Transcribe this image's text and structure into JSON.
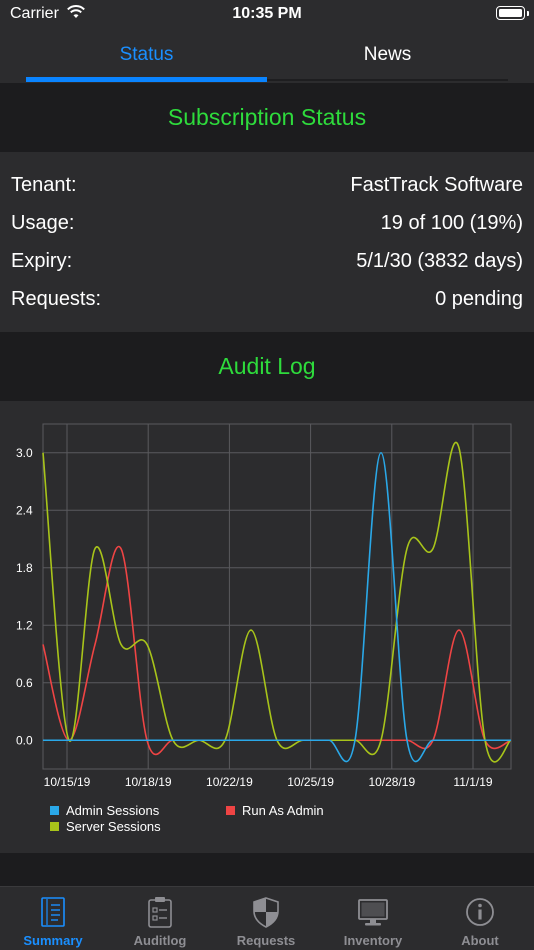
{
  "status_bar": {
    "carrier": "Carrier",
    "time": "10:35 PM"
  },
  "tabs": [
    {
      "label": "Status",
      "active": true
    },
    {
      "label": "News",
      "active": false
    }
  ],
  "subscription": {
    "header": "Subscription Status",
    "rows": [
      {
        "key": "Tenant:",
        "value": "FastTrack Software"
      },
      {
        "key": "Usage:",
        "value": "19 of 100 (19%)"
      },
      {
        "key": "Expiry:",
        "value": "5/1/30 (3832 days)"
      },
      {
        "key": "Requests:",
        "value": "0 pending"
      }
    ]
  },
  "audit": {
    "header": "Audit Log"
  },
  "colors": {
    "accent": "#0a84ff",
    "header_green": "#2edb3c",
    "admin_sessions": "#2aa8e8",
    "run_as_admin": "#ef4444",
    "server_sessions": "#a8c41a"
  },
  "chart_data": {
    "type": "line",
    "x_tick_labels": [
      "10/15/19",
      "10/18/19",
      "10/22/19",
      "10/25/19",
      "10/28/19",
      "11/1/19"
    ],
    "x": [
      0,
      1,
      2,
      3,
      4,
      5,
      6,
      7,
      8,
      9,
      10,
      11,
      12,
      13,
      14,
      15,
      16,
      17,
      18
    ],
    "ylim": [
      -0.3,
      3.3
    ],
    "y_ticks": [
      0.0,
      0.6,
      1.2,
      1.8,
      2.4,
      3.0
    ],
    "y_tick_labels": [
      "0.0",
      "0.6",
      "1.2",
      "1.8",
      "2.4",
      "3.0"
    ],
    "grid": true,
    "legend_position": "bottom-left",
    "series": [
      {
        "name": "Admin Sessions",
        "color": "#2aa8e8",
        "values": [
          0,
          0,
          0,
          0,
          0,
          0,
          0,
          0,
          0,
          0,
          0,
          0,
          0,
          3,
          0,
          0,
          0,
          0,
          0
        ]
      },
      {
        "name": "Run As Admin",
        "color": "#ef4444",
        "values": [
          1,
          0,
          1,
          2,
          0,
          0,
          0,
          0,
          0,
          0,
          0,
          0,
          0,
          0,
          0,
          0,
          1.15,
          0,
          0
        ]
      },
      {
        "name": "Server Sessions",
        "color": "#a8c41a",
        "values": [
          3,
          0,
          2,
          1,
          1,
          0,
          0,
          0,
          1.15,
          0,
          0,
          0,
          0,
          0,
          2,
          2,
          3.05,
          0,
          0
        ]
      }
    ]
  },
  "tabbar": [
    {
      "label": "Summary",
      "icon": "summary-icon",
      "active": true
    },
    {
      "label": "Auditlog",
      "icon": "auditlog-icon",
      "active": false
    },
    {
      "label": "Requests",
      "icon": "shield-icon",
      "active": false
    },
    {
      "label": "Inventory",
      "icon": "monitor-icon",
      "active": false
    },
    {
      "label": "About",
      "icon": "info-icon",
      "active": false
    }
  ]
}
